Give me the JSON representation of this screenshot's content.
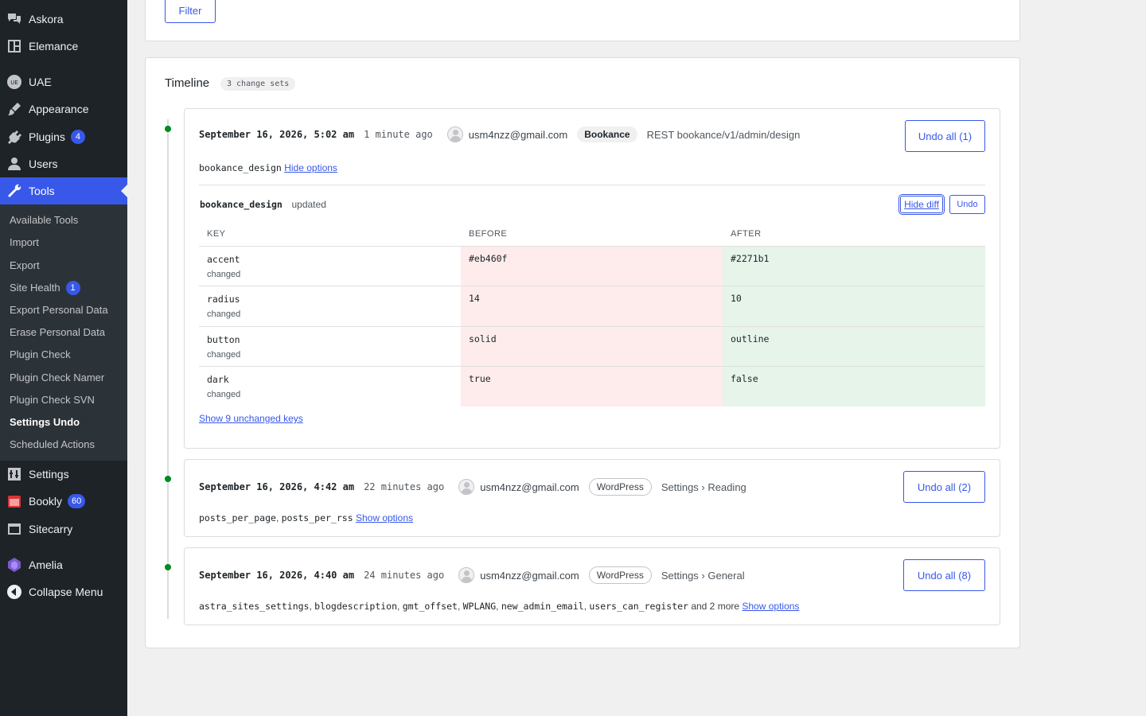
{
  "sidebar": {
    "items": [
      {
        "label": "Askora",
        "icon": "chat-bubbles-icon"
      },
      {
        "label": "Elemance",
        "icon": "layout-icon"
      },
      {
        "label": "UAE",
        "icon": "uae-logo-icon"
      },
      {
        "label": "Appearance",
        "icon": "paintbrush-icon"
      },
      {
        "label": "Plugins",
        "icon": "plugin-icon",
        "count": "4"
      },
      {
        "label": "Users",
        "icon": "user-icon"
      },
      {
        "label": "Tools",
        "icon": "wrench-icon"
      },
      {
        "label": "Settings",
        "icon": "settings-sliders-icon"
      },
      {
        "label": "Bookly",
        "icon": "calendar-icon",
        "count": "60"
      },
      {
        "label": "Sitecarry",
        "icon": "window-icon"
      },
      {
        "label": "Amelia",
        "icon": "amelia-logo-icon"
      },
      {
        "label": "Collapse Menu",
        "icon": "collapse-icon"
      }
    ],
    "submenu": [
      {
        "label": "Available Tools"
      },
      {
        "label": "Import"
      },
      {
        "label": "Export"
      },
      {
        "label": "Site Health",
        "count": "1"
      },
      {
        "label": "Export Personal Data"
      },
      {
        "label": "Erase Personal Data"
      },
      {
        "label": "Plugin Check"
      },
      {
        "label": "Plugin Check Namer"
      },
      {
        "label": "Plugin Check SVN"
      },
      {
        "label": "Settings Undo"
      },
      {
        "label": "Scheduled Actions"
      }
    ]
  },
  "filter": {
    "button_label": "Filter"
  },
  "timeline": {
    "title": "Timeline",
    "badge": "3 change sets",
    "entries": [
      {
        "timestamp": "September 16, 2026, 5:02 am",
        "ago": "1 minute ago",
        "user": "usm4nzz@gmail.com",
        "tag": "Bookance",
        "source": "REST bookance/v1/admin/design",
        "undo_all": "Undo all (1)",
        "keys": [
          "bookance_design"
        ],
        "options_toggle": "Hide options",
        "detail": {
          "option_name": "bookance_design",
          "status": "updated",
          "hide_diff": "Hide diff",
          "undo": "Undo",
          "columns": [
            "KEY",
            "BEFORE",
            "AFTER"
          ],
          "rows": [
            {
              "key": "accent",
              "note": "changed",
              "before": "#eb460f",
              "after": "#2271b1"
            },
            {
              "key": "radius",
              "note": "changed",
              "before": "14",
              "after": "10"
            },
            {
              "key": "button",
              "note": "changed",
              "before": "solid",
              "after": "outline"
            },
            {
              "key": "dark",
              "note": "changed",
              "before": "true",
              "after": "false"
            }
          ],
          "unchanged_link": "Show 9 unchanged keys"
        }
      },
      {
        "timestamp": "September 16, 2026, 4:42 am",
        "ago": "22 minutes ago",
        "user": "usm4nzz@gmail.com",
        "tag": "WordPress",
        "source": "Settings › Reading",
        "undo_all": "Undo all (2)",
        "keys_text_1": "posts_per_page",
        "keys_text_2": "posts_per_rss",
        "options_toggle": "Show options"
      },
      {
        "timestamp": "September 16, 2026, 4:40 am",
        "ago": "24 minutes ago",
        "user": "usm4nzz@gmail.com",
        "tag": "WordPress",
        "source": "Settings › General",
        "undo_all": "Undo all (8)",
        "keys": [
          "astra_sites_settings",
          "blogdescription",
          "gmt_offset",
          "WPLANG",
          "new_admin_email",
          "users_can_register"
        ],
        "more": "and 2 more",
        "options_toggle": "Show options"
      }
    ]
  },
  "colors": {
    "accent": "#3858e9",
    "sidebar": "#1d2327",
    "dot": "#008a20",
    "before_bg": "#fdeceb",
    "after_bg": "#e6f4ea"
  }
}
